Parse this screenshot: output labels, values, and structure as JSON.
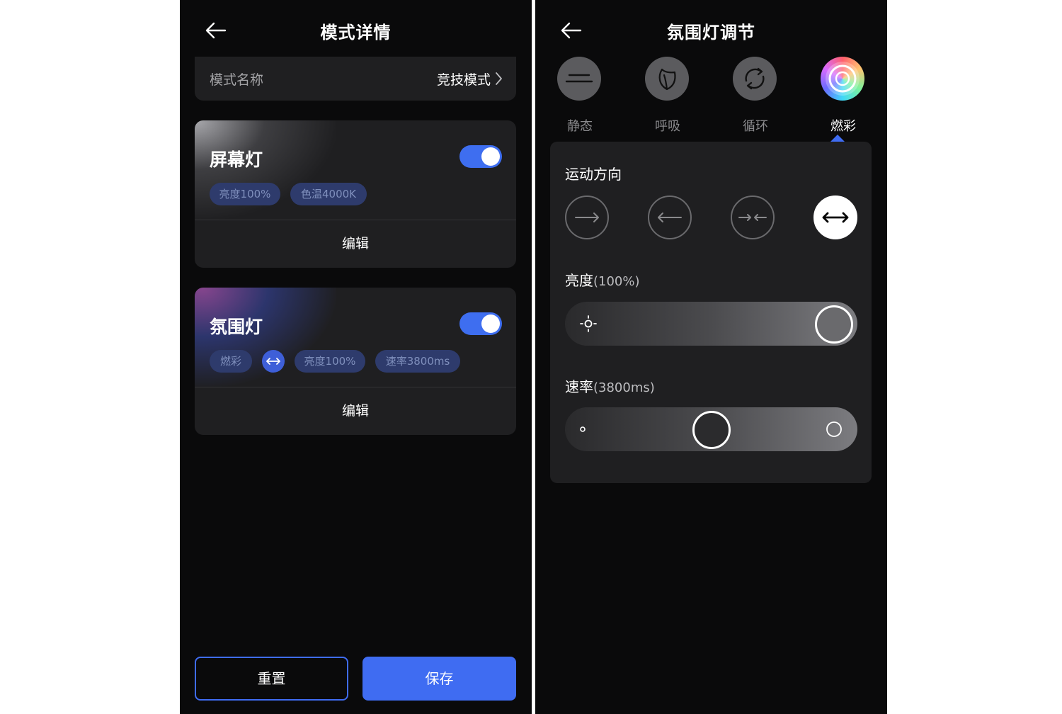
{
  "detail": {
    "title": "模式详情",
    "mode_name_label": "模式名称",
    "mode_name_value": "竞技模式",
    "screen_light": {
      "title": "屏幕灯",
      "enabled": true,
      "chips": [
        "亮度100%",
        "色温4000K"
      ],
      "edit_label": "编辑"
    },
    "ambient_light": {
      "title": "氛围灯",
      "enabled": true,
      "chips": [
        "燃彩",
        "亮度100%",
        "速率3800ms"
      ],
      "direction_icon": "bidirectional-arrow-icon",
      "edit_label": "编辑"
    },
    "reset_label": "重置",
    "save_label": "保存"
  },
  "ambient": {
    "title": "氛围灯调节",
    "modes": [
      {
        "label": "静态",
        "icon": "static-lines-icon"
      },
      {
        "label": "呼吸",
        "icon": "leaf-icon"
      },
      {
        "label": "循环",
        "icon": "cycle-arrows-icon"
      },
      {
        "label": "燃彩",
        "icon": "rainbow-ring-icon",
        "active": true
      }
    ],
    "direction_title": "运动方向",
    "directions": [
      {
        "icon": "arrow-right-icon"
      },
      {
        "icon": "arrow-left-icon"
      },
      {
        "icon": "arrows-inward-icon"
      },
      {
        "icon": "arrows-outward-icon",
        "active": true
      }
    ],
    "brightness_title": "亮度",
    "brightness_value": "(100%)",
    "brightness_level": 1.0,
    "speed_title": "速率",
    "speed_value": "(3800ms)",
    "speed_level": 0.5
  },
  "colors": {
    "accent": "#3f6cf2",
    "chip_bg": "#2e3b6c",
    "card_bg": "#1f1f21",
    "screen_bg": "#0a0a0b"
  }
}
